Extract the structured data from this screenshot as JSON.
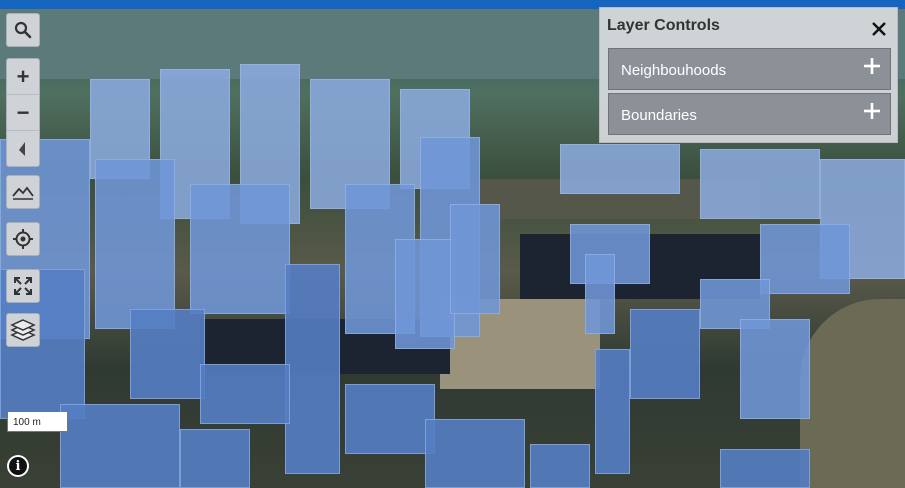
{
  "map": {
    "scale_label": "100 m"
  },
  "toolbar": {
    "search": "search-icon",
    "zoom_in": "+",
    "zoom_out": "−",
    "compass": "compass-icon",
    "terrain": "terrain-icon",
    "locate": "locate-icon",
    "fullscreen": "fullscreen-icon",
    "layers": "layers-icon"
  },
  "info_glyph": "i",
  "layer_controls": {
    "title": "Layer Controls",
    "items": [
      {
        "label": "Neighbouhoods"
      },
      {
        "label": "Boundaries"
      }
    ]
  },
  "colors": {
    "topbar": "#1565c0",
    "building": "#7096d7",
    "panel": "#d7d9dd",
    "accordion": "#8c9198"
  }
}
